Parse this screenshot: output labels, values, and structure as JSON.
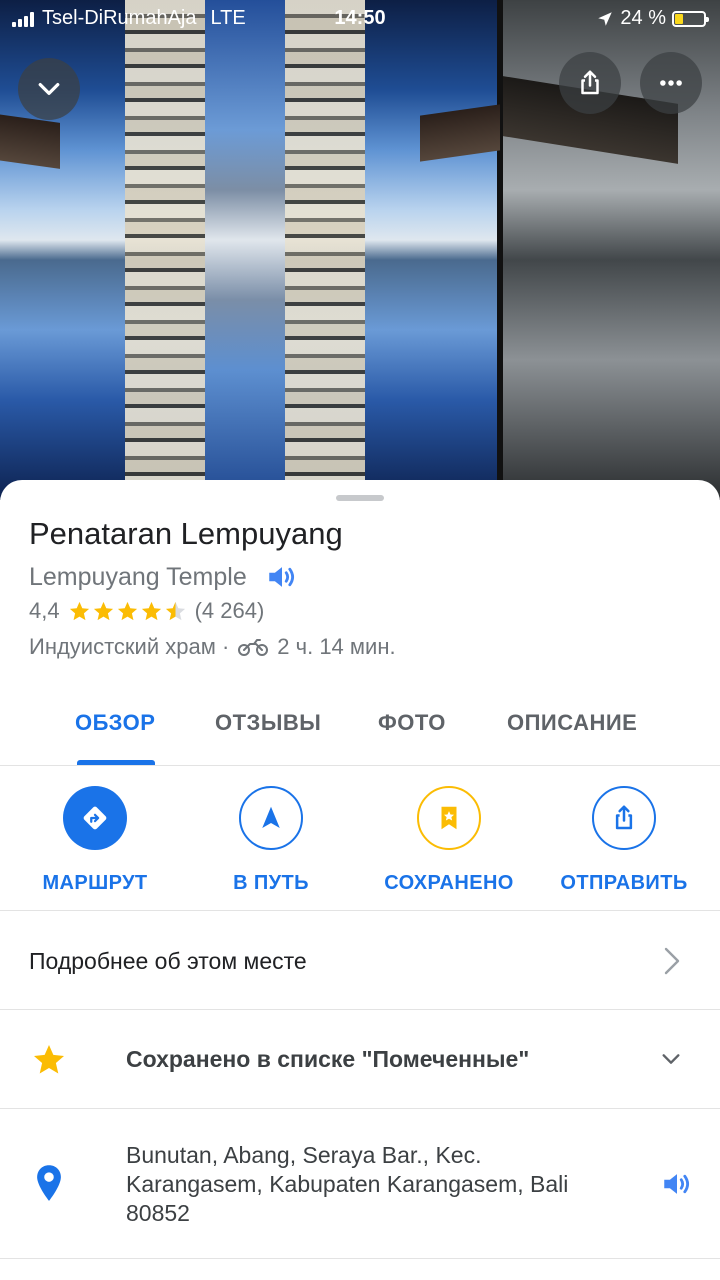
{
  "status_bar": {
    "carrier": "Tsel-DiRumahAja",
    "network": "LTE",
    "time": "14:50",
    "battery": "24 %"
  },
  "place": {
    "name": "Penataran Lempuyang",
    "alt_name": "Lempuyang Temple",
    "rating": "4,4",
    "stars": 4.4,
    "reviews_count": "(4 264)",
    "category": "Индуистский храм ·",
    "travel_time": "2 ч. 14 мин."
  },
  "tabs": [
    {
      "label": "ОБЗОР",
      "active": true
    },
    {
      "label": "ОТЗЫВЫ",
      "active": false
    },
    {
      "label": "ФОТО",
      "active": false
    },
    {
      "label": "ОПИСАНИЕ",
      "active": false
    }
  ],
  "actions": [
    {
      "label": "МАРШРУТ",
      "icon": "directions-icon"
    },
    {
      "label": "В ПУТЬ",
      "icon": "navigation-arrow-icon"
    },
    {
      "label": "СОХРАНЕНО",
      "icon": "bookmark-star-icon"
    },
    {
      "label": "ОТПРАВИТЬ",
      "icon": "share-icon"
    }
  ],
  "details": {
    "more_info": "Подробнее об этом месте",
    "saved_list": "Сохранено в списке \"Помеченные\"",
    "address_line1": "Bunutan, Abang, Seraya Bar., Kec.",
    "address_line2": "Karangasem, Kabupaten Karangasem, Bali",
    "address_line3": "80852"
  },
  "colors": {
    "accent": "#1a73e8",
    "star": "#fbbc04",
    "secondary_text": "#70757a"
  }
}
